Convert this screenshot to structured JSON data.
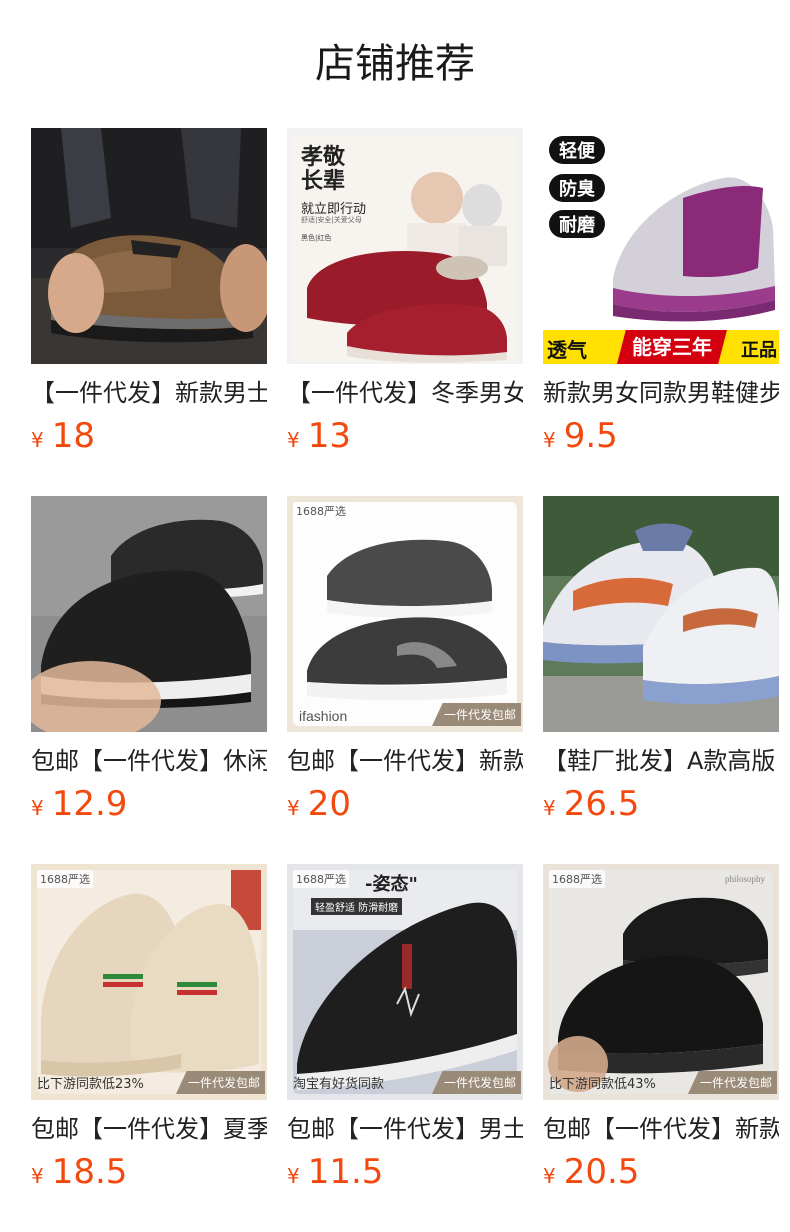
{
  "header": {
    "title": "店铺推荐"
  },
  "products": [
    {
      "name": "【一件代发】新款男士",
      "currency": "¥",
      "price": "18",
      "icon": "brown-leather-shoe-image"
    },
    {
      "name": "【一件代发】冬季男女",
      "currency": "¥",
      "price": "13",
      "icon": "red-winter-shoe-image",
      "promo": {
        "line1": "孝敬",
        "line2": "长辈",
        "line3": "就立即行动",
        "line4": "舒适|安全|关爱父母",
        "line5": "黑色|红色"
      }
    },
    {
      "name": "新款男女同款男鞋健步",
      "currency": "¥",
      "price": "9.5",
      "icon": "purple-knit-sneaker-image",
      "features": [
        "轻便",
        "防臭",
        "耐磨"
      ],
      "banner": [
        "透气",
        "能穿三年",
        "正品"
      ]
    },
    {
      "name": "包邮【一件代发】休闲",
      "currency": "¥",
      "price": "12.9",
      "icon": "black-knit-sneaker-image"
    },
    {
      "name": "包邮【一件代发】新款",
      "currency": "¥",
      "price": "20",
      "icon": "grey-running-shoe-image",
      "tag_top": "1688严选",
      "tag_brand": "ifashion",
      "tag_daifa": "一件代发包邮"
    },
    {
      "name": "【鞋厂批发】A款高版",
      "currency": "¥",
      "price": "26.5",
      "icon": "white-grey-running-shoe-image"
    },
    {
      "name": "包邮【一件代发】夏季",
      "currency": "¥",
      "price": "18.5",
      "icon": "beige-knit-sneaker-image",
      "tag_top": "1688严选",
      "tag_bottom": "比下游同款低23%",
      "tag_daifa": "一件代发包邮"
    },
    {
      "name": "包邮【一件代发】男士",
      "currency": "¥",
      "price": "11.5",
      "icon": "black-canvas-slip-on-image",
      "tag_top": "1688严选",
      "tag_bottom": "淘宝有好货同款",
      "tag_daifa": "一件代发包邮",
      "promo": {
        "line1": "-姿态\"",
        "line2": "轻盈舒适 防滑耐磨"
      }
    },
    {
      "name": "包邮【一件代发】新款",
      "currency": "¥",
      "price": "20.5",
      "icon": "black-mesh-sneaker-image",
      "tag_top": "1688严选",
      "tag_bottom": "比下游同款低43%",
      "tag_daifa": "一件代发包邮",
      "tag_corner": "philosophy"
    }
  ],
  "colors": {
    "price": "#f24a0e",
    "title": "#1a1a1a",
    "name": "#222222"
  }
}
